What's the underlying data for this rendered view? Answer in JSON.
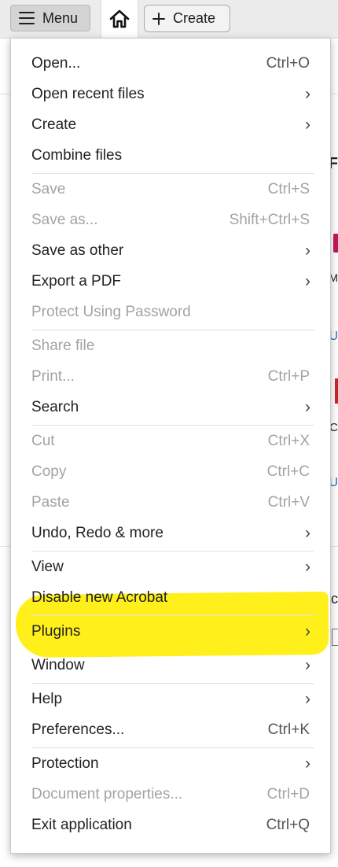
{
  "toolbar": {
    "menu_label": "Menu",
    "create_label": "Create"
  },
  "menu": {
    "items": [
      {
        "label": "Open...",
        "shortcut": "Ctrl+O",
        "submenu": false,
        "disabled": false
      },
      {
        "label": "Open recent files",
        "shortcut": "",
        "submenu": true,
        "disabled": false
      },
      {
        "label": "Create",
        "shortcut": "",
        "submenu": true,
        "disabled": false
      },
      {
        "label": "Combine files",
        "shortcut": "",
        "submenu": false,
        "disabled": false
      },
      {
        "label": "Save",
        "shortcut": "Ctrl+S",
        "submenu": false,
        "disabled": true
      },
      {
        "label": "Save as...",
        "shortcut": "Shift+Ctrl+S",
        "submenu": false,
        "disabled": true
      },
      {
        "label": "Save as other",
        "shortcut": "",
        "submenu": true,
        "disabled": false
      },
      {
        "label": "Export a PDF",
        "shortcut": "",
        "submenu": true,
        "disabled": false
      },
      {
        "label": "Protect Using Password",
        "shortcut": "",
        "submenu": false,
        "disabled": true
      },
      {
        "label": "Share file",
        "shortcut": "",
        "submenu": false,
        "disabled": true
      },
      {
        "label": "Print...",
        "shortcut": "Ctrl+P",
        "submenu": false,
        "disabled": true
      },
      {
        "label": "Search",
        "shortcut": "",
        "submenu": true,
        "disabled": false
      },
      {
        "label": "Cut",
        "shortcut": "Ctrl+X",
        "submenu": false,
        "disabled": true
      },
      {
        "label": "Copy",
        "shortcut": "Ctrl+C",
        "submenu": false,
        "disabled": true
      },
      {
        "label": "Paste",
        "shortcut": "Ctrl+V",
        "submenu": false,
        "disabled": true
      },
      {
        "label": "Undo, Redo & more",
        "shortcut": "",
        "submenu": true,
        "disabled": false
      },
      {
        "label": "View",
        "shortcut": "",
        "submenu": true,
        "disabled": false
      },
      {
        "label": "Disable new Acrobat",
        "shortcut": "",
        "submenu": false,
        "disabled": false
      },
      {
        "label": "Plugins",
        "shortcut": "",
        "submenu": true,
        "disabled": false,
        "highlighted": true
      },
      {
        "label": "Window",
        "shortcut": "",
        "submenu": true,
        "disabled": false
      },
      {
        "label": "Help",
        "shortcut": "",
        "submenu": true,
        "disabled": false
      },
      {
        "label": "Preferences...",
        "shortcut": "Ctrl+K",
        "submenu": false,
        "disabled": false
      },
      {
        "label": "Protection",
        "shortcut": "",
        "submenu": true,
        "disabled": false
      },
      {
        "label": "Document properties...",
        "shortcut": "Ctrl+D",
        "submenu": false,
        "disabled": true
      },
      {
        "label": "Exit application",
        "shortcut": "Ctrl+Q",
        "submenu": false,
        "disabled": false
      }
    ],
    "chevron": "›",
    "highlight_color": "#ffef1a",
    "disabled_color": "#a3a3a3"
  },
  "background": {
    "fragments": [
      {
        "text": "F",
        "color": "#222222"
      },
      {
        "text": "M",
        "color": "#333333"
      },
      {
        "text": "U",
        "color": "#1a73c8"
      },
      {
        "text": "C",
        "color": "#333333"
      },
      {
        "text": "U",
        "color": "#1a73c8"
      },
      {
        "text": "c",
        "color": "#222222"
      }
    ]
  }
}
